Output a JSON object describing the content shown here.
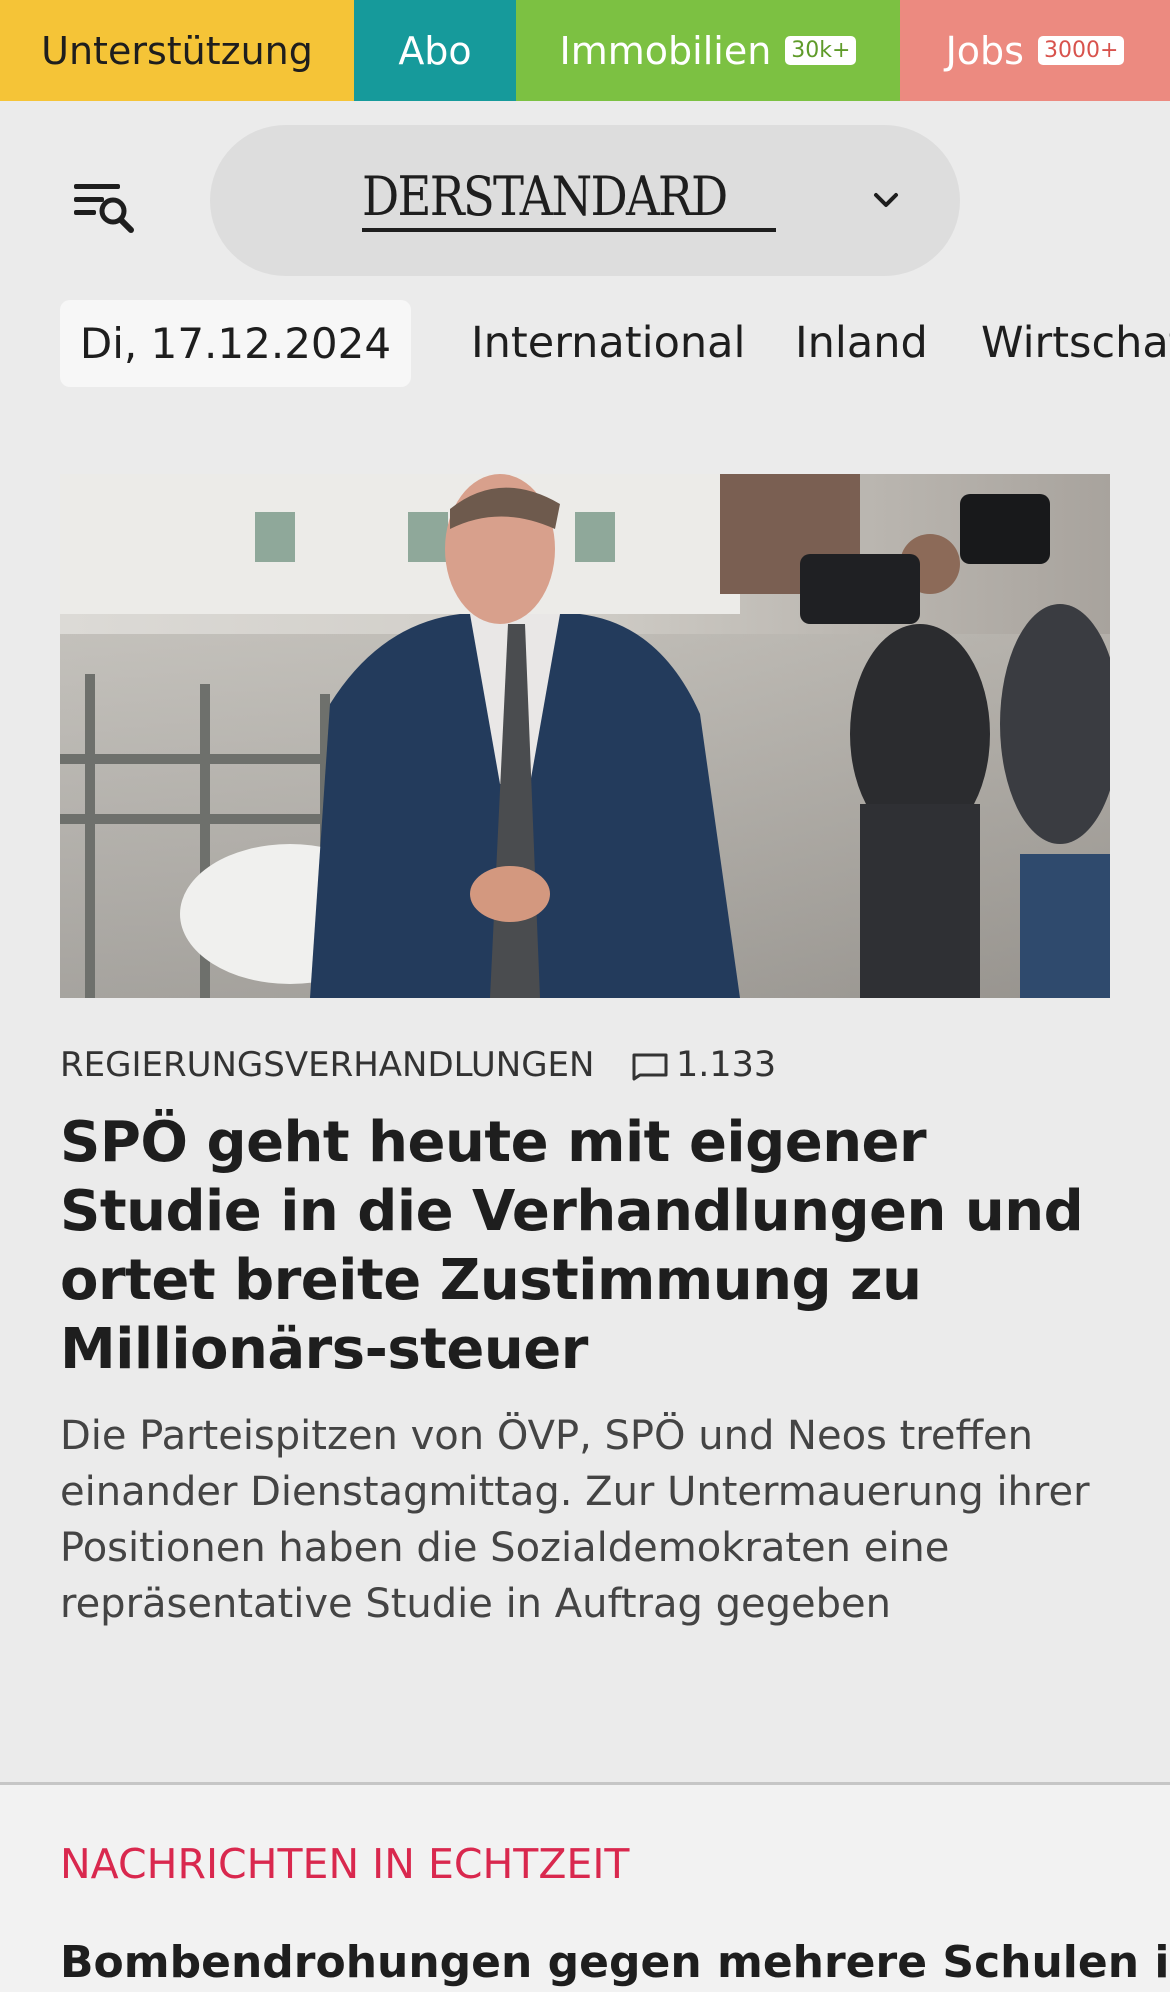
{
  "topbar": {
    "support_label": "Unterstützung",
    "abo_label": "Abo",
    "immobilien_label": "Immobilien",
    "immobilien_badge": "30k+",
    "jobs_label": "Jobs",
    "jobs_badge": "3000+",
    "colors": {
      "support": "#f5c437",
      "abo": "#169a9b",
      "immobilien": "#7cc142",
      "jobs": "#ec8a80"
    }
  },
  "header": {
    "logo_text": "DERSTANDARD",
    "menu_icon": "menu-search-icon",
    "dropdown_icon": "chevron-down-icon"
  },
  "nav": {
    "date": "Di, 17.12.2024",
    "items": [
      "International",
      "Inland",
      "Wirtschaft"
    ]
  },
  "article": {
    "kicker": "REGIERUNGSVERHANDLUNGEN",
    "comment_count": "1.133",
    "headline": "SPÖ geht heute mit eigener Studie in die Verhandlungen und ortet breite Zustimmung zu Millionärs-steuer",
    "teaser": "Die Parteispitzen von ÖVP, SPÖ und Neos treffen einander Dienstagmittag. Zur Untermauerung ihrer Positionen haben die Sozialdemokraten eine repräsentative Studie in Auftrag gegeben"
  },
  "live": {
    "section_title": "NACHRICHTEN IN ECHTZEIT",
    "first_item": "Bombendrohungen gegen mehrere Schulen in",
    "accent_color": "#d9284e"
  }
}
